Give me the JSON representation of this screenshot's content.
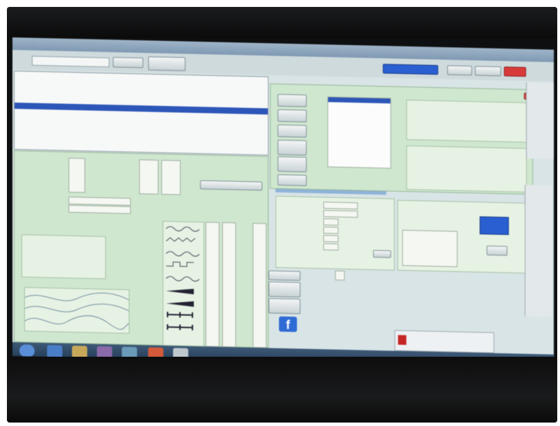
{
  "photo": {
    "subject": "monitor-displaying-desktop-application",
    "monitor_color": "#0e0f10",
    "screen_tint": "#d8e4e6",
    "panel_green": "#cfe7cf",
    "selection_blue": "#2c56b8",
    "red_button": "#d83a3a"
  },
  "app": {
    "title": "",
    "main_list_rows": 12,
    "selected_row_index": 5,
    "signal_list_rows": 16,
    "wave_rows": 9
  },
  "icons": {
    "facebook": "facebook-icon",
    "notification": "pdf-icon",
    "taskbar": [
      "start-orb-icon",
      "ie-icon",
      "folder-icon",
      "media-icon",
      "network-icon",
      "chrome-icon",
      "app-icon"
    ]
  }
}
